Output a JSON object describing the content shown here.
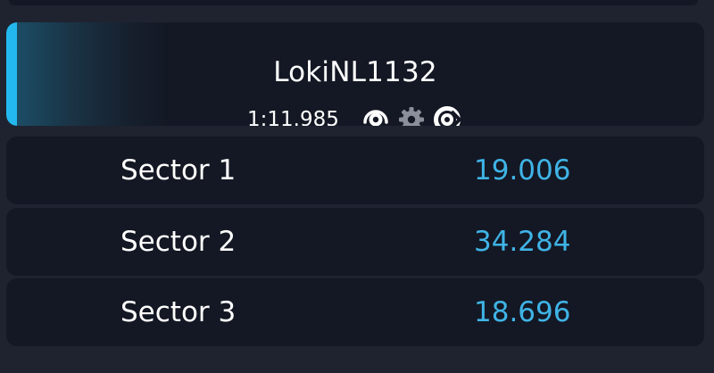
{
  "driver": {
    "name": "LokiNL1132",
    "lap_time": "1:11.985",
    "assists": [
      {
        "icon": "traction-control-icon"
      },
      {
        "icon": "gear-icon"
      },
      {
        "icon": "abs-icon"
      }
    ]
  },
  "sectors": [
    {
      "label": "Sector 1",
      "time": "19.006"
    },
    {
      "label": "Sector 2",
      "time": "34.284"
    },
    {
      "label": "Sector 3",
      "time": "18.696"
    }
  ],
  "colors": {
    "background": "#1f2330",
    "card": "#141824",
    "accent": "#23b9ef",
    "sector_time": "#3fb4e6",
    "text": "#ffffff",
    "gear_icon": "#8a8f9a"
  }
}
